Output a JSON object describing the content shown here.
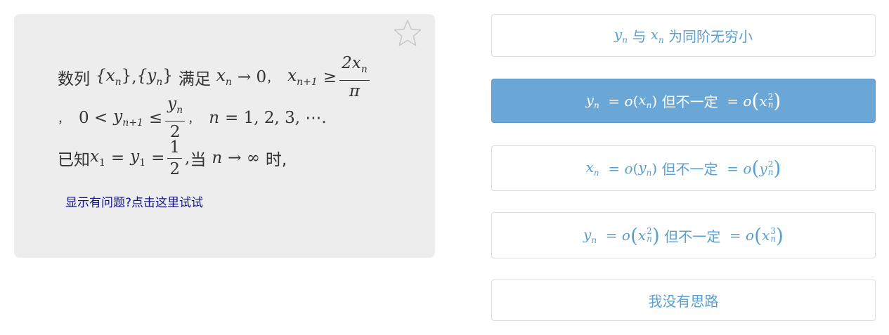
{
  "question": {
    "line1": {
      "lead": "数列",
      "seq_x": "{x",
      "seq_x_sub": "n",
      "seq_x_close": "}",
      "comma": ",",
      "seq_y": "{y",
      "seq_y_sub": "n",
      "seq_y_close": "}",
      "cond": "满足",
      "xn": "x",
      "xn_sub": "n",
      "arrow_zero": "→ 0",
      "sep": "，",
      "xn1": "x",
      "xn1_sub": "n+1",
      "geq": "≥",
      "frac_num": "2x",
      "frac_num_sub": "n",
      "frac_den": "π"
    },
    "line2": {
      "lead_sep": "，",
      "zero_lt": "0 <",
      "yn1": "y",
      "yn1_sub": "n+1",
      "leq": "≤",
      "frac_num": "y",
      "frac_num_sub": "n",
      "frac_den": "2",
      "sep": "，",
      "n_eq": "n",
      "n_values": "= 1, 2, 3, ⋯."
    },
    "line3": {
      "lead": "已知",
      "x1": "x",
      "x1_sub": "1",
      "eq1": "=",
      "y1": "y",
      "y1_sub": "1",
      "eq2": "=",
      "frac_num": "1",
      "frac_den": "2",
      "comma": ",",
      "when": "当",
      "n": "n",
      "to_inf": "→ ∞",
      "tail": "时,"
    },
    "report_link": "显示有问题?点击这里试试",
    "favorite_icon": "star-outline-icon"
  },
  "options": [
    {
      "id": "a",
      "selected": false,
      "parts": {
        "v1": "y",
        "v1_sub": "n",
        "w1": "与",
        "v2": "x",
        "v2_sub": "n",
        "text": "为同阶无穷小"
      }
    },
    {
      "id": "b",
      "selected": true,
      "parts": {
        "v1": "y",
        "v1_sub": "n",
        "eq": "=",
        "o": "o",
        "open": "(",
        "v2": "x",
        "v2_sub": "n",
        "close": ")",
        "text": "但不一定",
        "eq2": "=",
        "o2": "o",
        "v3": "x",
        "v3_sup": "2",
        "v3_sub": "n"
      }
    },
    {
      "id": "c",
      "selected": false,
      "parts": {
        "v1": "x",
        "v1_sub": "n",
        "eq": "=",
        "o": "o",
        "open": "(",
        "v2": "y",
        "v2_sub": "n",
        "close": ")",
        "text": "但不一定",
        "eq2": "=",
        "o2": "o",
        "v3": "y",
        "v3_sup": "2",
        "v3_sub": "n"
      }
    },
    {
      "id": "d",
      "selected": false,
      "parts": {
        "v1": "y",
        "v1_sub": "n",
        "eq": "=",
        "o": "o",
        "v2": "x",
        "v2_sup": "2",
        "v2_sub": "n",
        "text": "但不一定",
        "eq2": "=",
        "o2": "o",
        "v3": "x",
        "v3_sup": "3",
        "v3_sub": "n"
      }
    },
    {
      "id": "e",
      "selected": false,
      "parts": {
        "text": "我没有思路"
      }
    }
  ],
  "colors": {
    "card_bg": "#ededed",
    "option_text": "#5a9fcf",
    "selected_bg": "#6aa6d6",
    "link": "#13128a"
  }
}
